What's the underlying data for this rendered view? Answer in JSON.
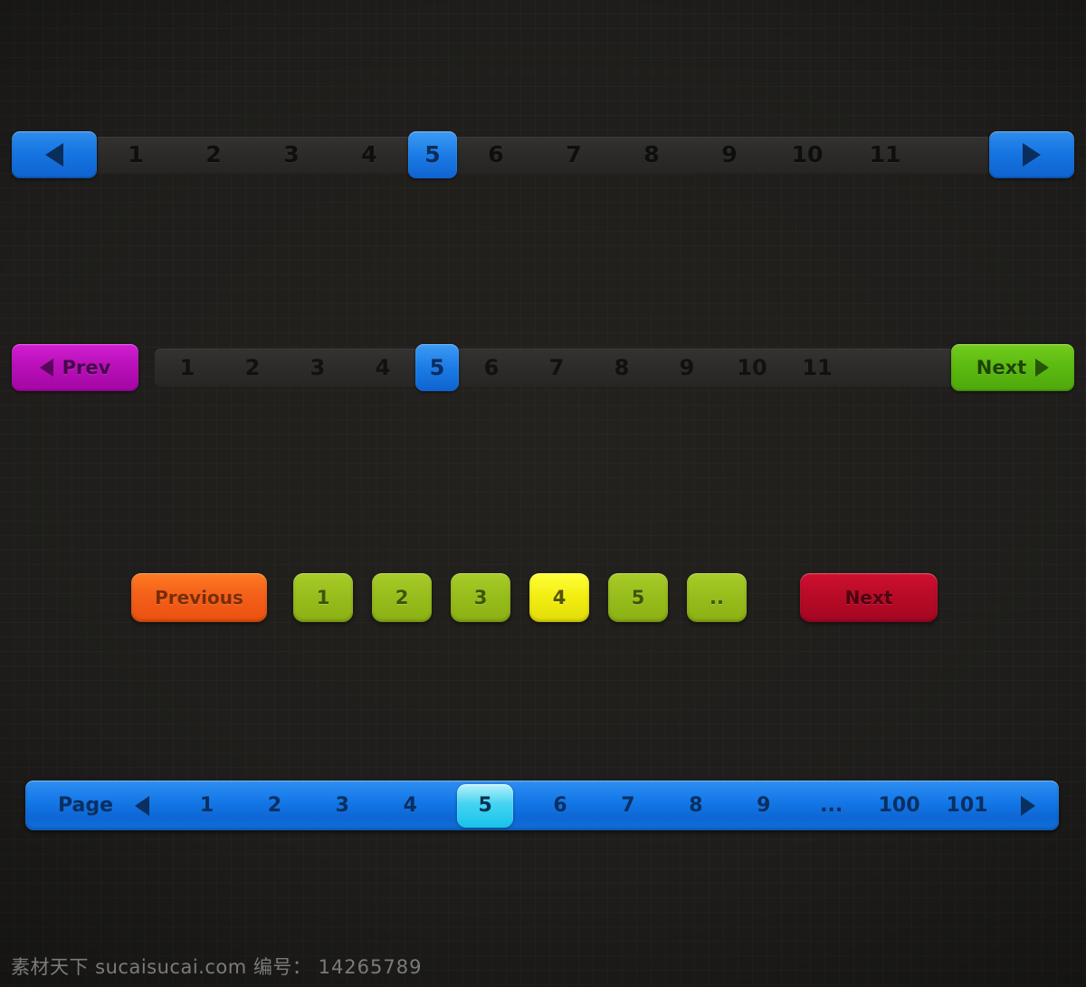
{
  "background": {
    "base_color": "#1e1d1b",
    "grid_line_color": "rgba(255,255,255,0.022)"
  },
  "pager_one": {
    "name": "blue-arrow-pagination",
    "prev_icon": "triangle-left-icon",
    "next_icon": "triangle-right-icon",
    "accent_color": "#1676e2",
    "active_page": "5",
    "pages": [
      "1",
      "2",
      "3",
      "4",
      "5",
      "6",
      "7",
      "8",
      "9",
      "10",
      "11"
    ]
  },
  "pager_two": {
    "name": "prev-next-pagination",
    "prev_label": "Prev",
    "next_label": "Next",
    "prev_icon": "triangle-left-icon",
    "next_icon": "triangle-right-icon",
    "prev_color": "#b910b9",
    "next_color": "#5cbb10",
    "active_color": "#1b7ce6",
    "active_page": "5",
    "pages": [
      "1",
      "2",
      "3",
      "4",
      "5",
      "6",
      "7",
      "8",
      "9",
      "10",
      "11"
    ]
  },
  "pager_three": {
    "name": "rounded-color-button-pagination",
    "previous_label": "Previous",
    "next_label": "Next",
    "previous_color": "#f4601a",
    "next_color": "#b90b28",
    "number_color": "#97bd1c",
    "active_color": "#f3ef12",
    "active_page": "4",
    "pages": [
      "1",
      "2",
      "3",
      "4",
      "5",
      ".."
    ]
  },
  "pager_four": {
    "name": "blue-bar-pagination",
    "label": "Page",
    "prev_icon": "triangle-left-icon",
    "next_icon": "triangle-right-icon",
    "bar_color": "#1478e8",
    "active_color": "#46d3f2",
    "active_page": "5",
    "pages": [
      "1",
      "2",
      "3",
      "4",
      "5",
      "6",
      "7",
      "8",
      "9",
      "...",
      "100",
      "101"
    ]
  },
  "watermark": {
    "site": "素材天下 sucaisucai.com",
    "id_label": "编号：",
    "id_value": "14265789"
  }
}
